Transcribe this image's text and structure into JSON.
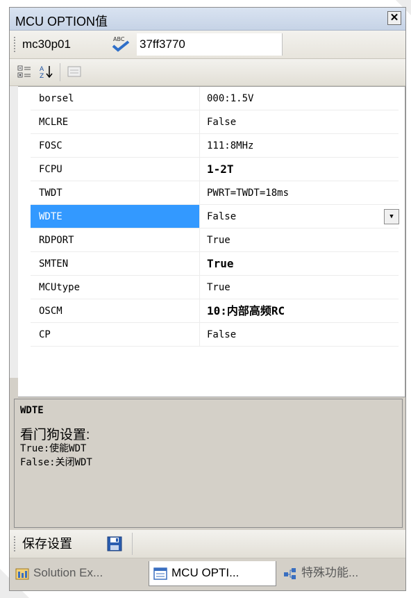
{
  "window": {
    "title": "MCU OPTION值",
    "close_label": "✕"
  },
  "toolbar1": {
    "chip_label": "mc30p01",
    "chip_value": "37ff3770"
  },
  "toolbar2": {
    "icons": [
      "categorized-icon",
      "alphabetical-sort-icon",
      "property-pages-icon"
    ]
  },
  "properties": [
    {
      "name": "borsel",
      "value": "000:1.5V",
      "bold": false
    },
    {
      "name": "MCLRE",
      "value": "False",
      "bold": false
    },
    {
      "name": "FOSC",
      "value": "111:8MHz",
      "bold": false
    },
    {
      "name": "FCPU",
      "value": "1-2T",
      "bold": true
    },
    {
      "name": "TWDT",
      "value": "PWRT=TWDT=18ms",
      "bold": false
    },
    {
      "name": "WDTE",
      "value": "False",
      "bold": false,
      "selected": true
    },
    {
      "name": "RDPORT",
      "value": "True",
      "bold": false
    },
    {
      "name": "SMTEN",
      "value": "True",
      "bold": true
    },
    {
      "name": "MCUtype",
      "value": "True",
      "bold": false
    },
    {
      "name": "OSCM",
      "value": "10:内部高频RC",
      "bold": true
    },
    {
      "name": "CP",
      "value": "False",
      "bold": false
    }
  ],
  "description": {
    "title": "WDTE",
    "line1": "看门狗设置:",
    "line2": "True:使能WDT",
    "line3": "False:关闭WDT"
  },
  "toolbar3": {
    "save_label": "保存设置"
  },
  "tabs": [
    {
      "label": "Solution Ex...",
      "icon": "solution-explorer-icon",
      "active": false
    },
    {
      "label": "MCU OPTI...",
      "icon": "property-window-icon",
      "active": true
    },
    {
      "label": "特殊功能...",
      "icon": "special-function-icon",
      "active": false
    }
  ],
  "colors": {
    "selection": "#3399ff",
    "titlebar": "#c6d3e6"
  }
}
